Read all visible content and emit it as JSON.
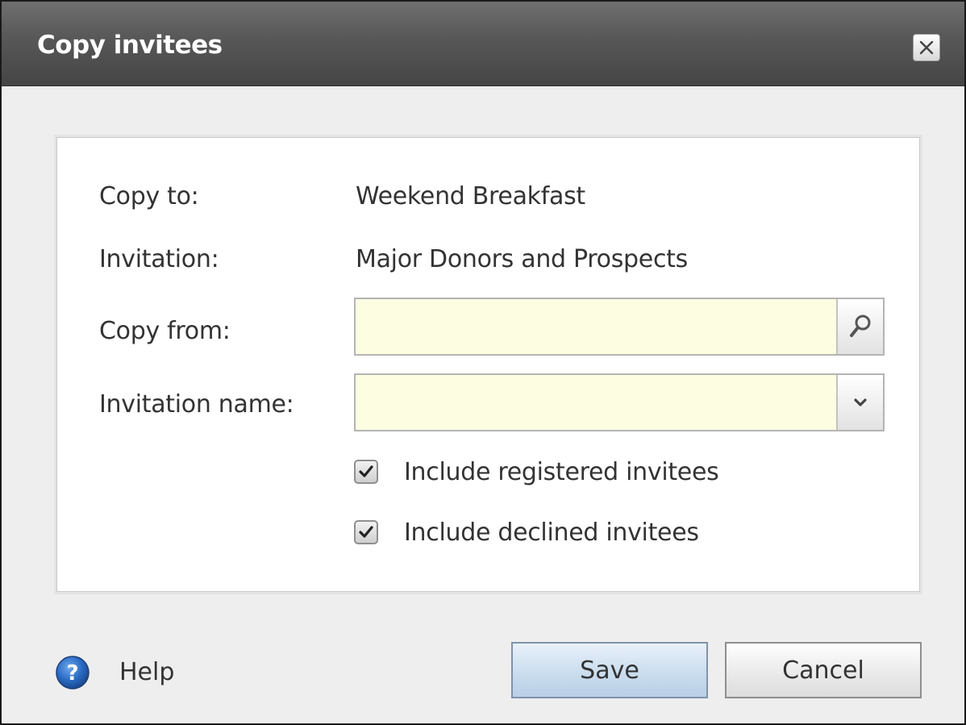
{
  "dialog": {
    "title": "Copy invitees",
    "close_icon": "close-icon"
  },
  "form": {
    "copy_to_label": "Copy to:",
    "copy_to_value": "Weekend Breakfast",
    "invitation_label": "Invitation:",
    "invitation_value": "Major Donors and Prospects",
    "copy_from_label": "Copy from:",
    "copy_from_value": "",
    "copy_from_button_icon": "search-icon",
    "invitation_name_label": "Invitation name:",
    "invitation_name_value": "",
    "invitation_name_button_icon": "chevron-down-icon",
    "include_registered_label": "Include registered invitees",
    "include_registered_checked": true,
    "include_declined_label": "Include declined invitees",
    "include_declined_checked": true
  },
  "footer": {
    "help_label": "Help",
    "help_icon": "help-icon",
    "save_label": "Save",
    "cancel_label": "Cancel"
  },
  "colors": {
    "titlebar": "#575757",
    "field_background": "#fcfde1",
    "save_button": "#cddff0",
    "help_icon": "#2a6bc4"
  }
}
